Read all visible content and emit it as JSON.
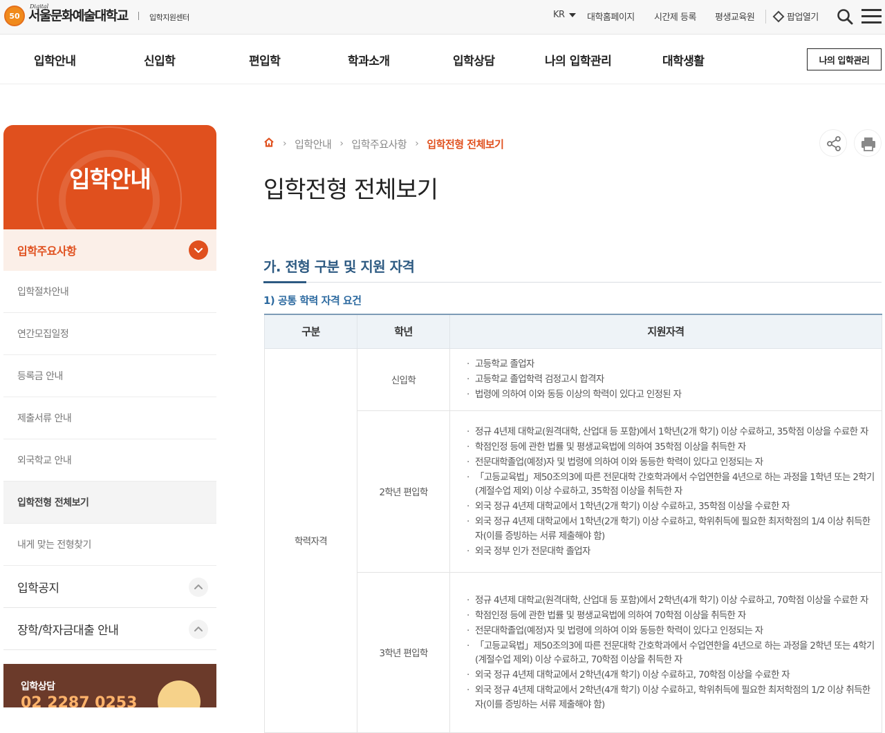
{
  "header": {
    "logo_badge": "50",
    "logo_digital": "Digital",
    "logo_name": "서울문화예술대학교",
    "logo_sub": "입학지원센터",
    "lang": "KR",
    "links": [
      "대학홈페이지",
      "시간제 등록",
      "평생교육원"
    ],
    "popup_label": "팝업열기"
  },
  "nav": {
    "items": [
      "입학안내",
      "신입학",
      "편입학",
      "학과소개",
      "입학상담",
      "나의 입학관리",
      "대학생활"
    ],
    "my_button": "나의 입학관리"
  },
  "sidebar": {
    "hero_title": "입학안내",
    "active_group": "입학주요사항",
    "items": [
      "입학절차안내",
      "연간모집일정",
      "등록금 안내",
      "제출서류 안내",
      "외국학교 안내",
      "입학전형 전체보기",
      "내게 맞는 전형찾기"
    ],
    "current_index": 5,
    "groups": [
      "입학공지",
      "장학/학자금대출 안내"
    ],
    "consult_title": "입학상담",
    "consult_phone": "02 2287 0253"
  },
  "content": {
    "breadcrumb": [
      "입학안내",
      "입학주요사항",
      "입학전형 전체보기"
    ],
    "page_title": "입학전형 전체보기",
    "section_title": "가. 전형 구분 및 지원 자격",
    "sub_title": "1) 공통 학력 자격 요건",
    "table": {
      "headers": [
        "구분",
        "학년",
        "지원자격"
      ],
      "category": "학력자격",
      "rows": [
        {
          "grade": "신입학",
          "items": [
            "고등학교 졸업자",
            "고등학교 졸업학력 검정고시 합격자",
            "법령에 의하여 이와 동등 이상의 학력이 있다고 인정된 자"
          ]
        },
        {
          "grade": "2학년 편입학",
          "items": [
            "정규 4년제 대학교(원격대학, 산업대 등 포함)에서 1학년(2개 학기) 이상 수료하고, 35학점 이상을 수료한 자",
            "학점인정 등에 관한 법률 및 평생교육법에 의하여 35학점 이상을 취득한 자",
            "전문대학졸업(예정)자 및 법령에 의하여 이와 동등한 학력이 있다고 인정되는 자",
            "「고등교육법」제50조의3에 따른 전문대학 간호학과에서 수업연한을 4년으로 하는 과정을 1학년 또는 2학기(계절수업 제외) 이상 수료하고, 35학점 이상을 취득한 자",
            "외국 정규 4년제 대학교에서 1학년(2개 학기) 이상 수료하고, 35학점 이상을 수료한 자",
            "외국 정규 4년제 대학교에서 1학년(2개 학기) 이상 수료하고, 학위취득에 필요한 최저학점의 1/4 이상 취득한 자(이를 증빙하는 서류 제출해야 함)",
            "외국 정부 인가 전문대학 졸업자"
          ]
        },
        {
          "grade": "3학년 편입학",
          "items": [
            "정규 4년제 대학교(원격대학, 산업대 등 포함)에서 2학년(4개 학기) 이상 수료하고, 70학점 이상을 수료한 자",
            "학점인정 등에 관한 법률 및 평생교육법에 의하여 70학점 이상을 취득한 자",
            "전문대학졸업(예정)자 및 법령에 의하여 이와 동등한 학력이 있다고 인정되는 자",
            "「고등교육법」제50조의3에 따른 전문대학 간호학과에서 수업연한을 4년으로 하는 과정을 2학년 또는 4학기(계절수업 제외) 이상 수료하고, 70학점 이상을 취득한 자",
            "외국 정규 4년제 대학교에서 2학년(4개 학기) 이상 수료하고, 70학점 이상을 수료한 자",
            "외국 정규 4년제 대학교에서 2학년(4개 학기) 이상 수료하고, 학위취득에 필요한 최저학점의 1/2 이상 취득한 자(이를 증빙하는 서류 제출해야 함)"
          ]
        }
      ]
    }
  },
  "colors": {
    "accent": "#e0501e",
    "section_blue": "#2d5a82"
  }
}
